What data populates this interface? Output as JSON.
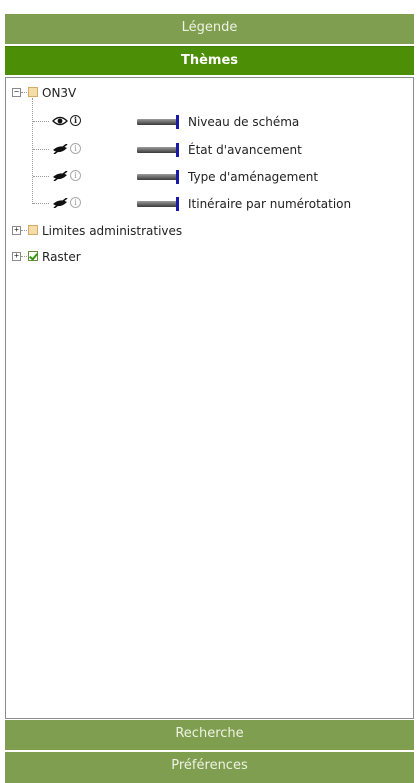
{
  "panels": {
    "legende": "Légende",
    "themes": "Thèmes",
    "recherche": "Recherche",
    "preferences": "Préférences"
  },
  "tree": {
    "on3v": {
      "label": "ON3V",
      "expander": "−",
      "layers": [
        {
          "label": "Niveau de schéma",
          "visible": true,
          "info": "i"
        },
        {
          "label": "État d'avancement",
          "visible": false,
          "info": "i"
        },
        {
          "label": "Type d'aménagement",
          "visible": false,
          "info": "i"
        },
        {
          "label": "Itinéraire par numérotation",
          "visible": false,
          "info": "i"
        }
      ]
    },
    "limites": {
      "label": "Limites administratives",
      "expander": "+"
    },
    "raster": {
      "label": "Raster",
      "expander": "+"
    }
  },
  "colors": {
    "header_active": "#4c8f07",
    "header_inactive": "#7f9e4f",
    "slider_handle": "#1a1aa6"
  },
  "icons": {
    "visible": "eye-icon",
    "hidden": "eye-slash-icon",
    "info": "info-icon"
  }
}
